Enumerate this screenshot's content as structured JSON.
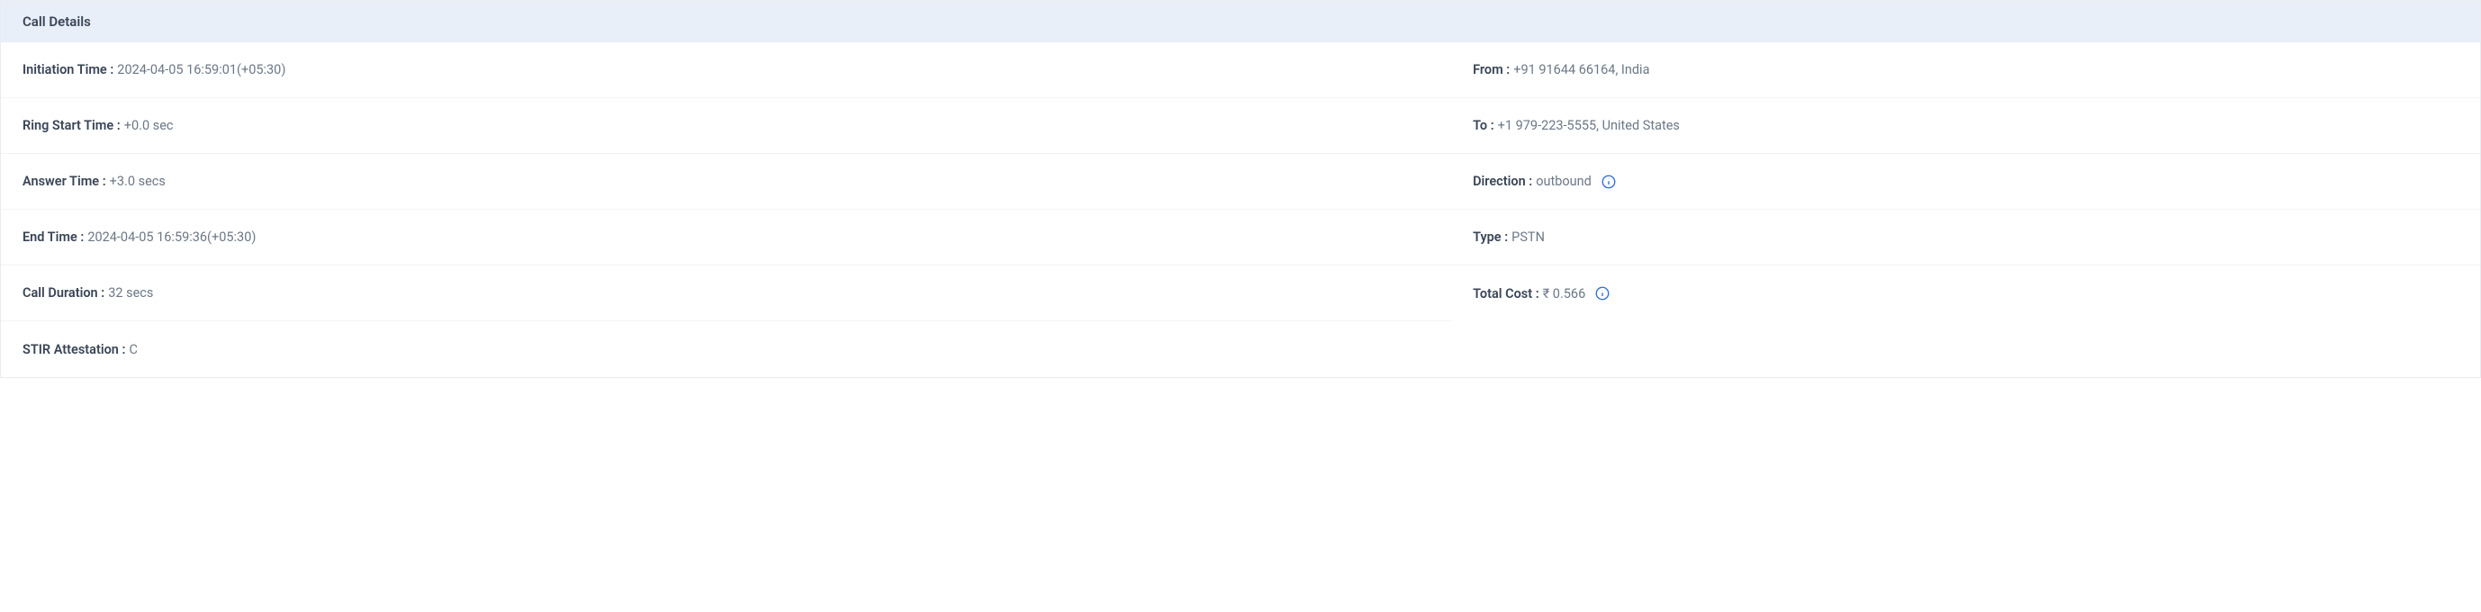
{
  "panel": {
    "title": "Call Details",
    "left": {
      "initiation_time": {
        "label": "Initiation Time :",
        "value": "2024-04-05 16:59:01(+05:30)"
      },
      "ring_start_time": {
        "label": "Ring Start Time :",
        "value": "+0.0 sec"
      },
      "answer_time": {
        "label": "Answer Time :",
        "value": "+3.0 secs"
      },
      "end_time": {
        "label": "End Time :",
        "value": "2024-04-05 16:59:36(+05:30)"
      },
      "call_duration": {
        "label": "Call Duration :",
        "value": "32 secs"
      },
      "stir": {
        "label": "STIR Attestation :",
        "value": "C"
      }
    },
    "right": {
      "from": {
        "label": "From :",
        "value": "+91 91644 66164, India"
      },
      "to": {
        "label": "To :",
        "value": "+1 979-223-5555, United States"
      },
      "direction": {
        "label": "Direction :",
        "value": "outbound"
      },
      "type": {
        "label": "Type :",
        "value": "PSTN"
      },
      "total_cost": {
        "label": "Total Cost :",
        "value": "₹ 0.566"
      }
    }
  }
}
